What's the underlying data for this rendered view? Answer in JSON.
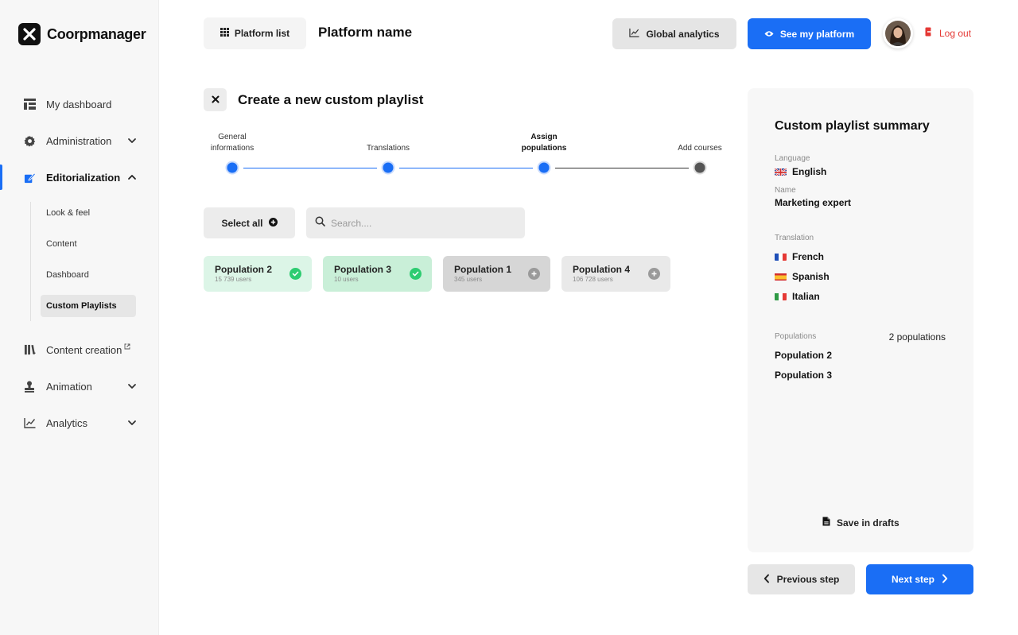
{
  "app": {
    "brand": "Coorpmanager",
    "accent": "#1a6ef5",
    "danger": "#e53935",
    "success": "#2ecc71"
  },
  "topbar": {
    "platform_list_label": "Platform list",
    "platform_name": "Platform name",
    "global_analytics_label": "Global analytics",
    "see_platform_label": "See my platform",
    "logout_label": "Log out"
  },
  "sidebar": {
    "items": [
      {
        "label": "My dashboard",
        "icon": "dashboard-icon"
      },
      {
        "label": "Administration",
        "icon": "gear-icon",
        "expandable": true
      },
      {
        "label": "Editorialization",
        "icon": "edit-icon",
        "expanded": true,
        "active": true
      },
      {
        "label": "Content creation",
        "icon": "library-icon",
        "external": true
      },
      {
        "label": "Animation",
        "icon": "stamp-icon",
        "expandable": true
      },
      {
        "label": "Analytics",
        "icon": "chart-icon",
        "expandable": true
      }
    ],
    "subitems": [
      {
        "label": "Look & feel"
      },
      {
        "label": "Content"
      },
      {
        "label": "Dashboard"
      },
      {
        "label": "Custom Playlists",
        "active": true
      }
    ]
  },
  "page": {
    "title": "Create a new custom playlist"
  },
  "stepper": {
    "steps": [
      {
        "line1": "General",
        "line2": "informations",
        "state": "done"
      },
      {
        "line1": "",
        "line2": "Translations",
        "state": "done"
      },
      {
        "line1": "Assign",
        "line2": "populations",
        "state": "current"
      },
      {
        "line1": "",
        "line2": "Add courses",
        "state": "todo"
      }
    ]
  },
  "selection": {
    "select_all_label": "Select all",
    "search_placeholder": "Search....",
    "search_value": ""
  },
  "populations": [
    {
      "name": "Population 2",
      "users": "15 739 users",
      "selected": true
    },
    {
      "name": "Population 3",
      "users": "10 users",
      "selected": true
    },
    {
      "name": "Population 1",
      "users": "345 users",
      "selected": false
    },
    {
      "name": "Population 4",
      "users": "106 728 users",
      "selected": false
    }
  ],
  "summary": {
    "title": "Custom playlist summary",
    "language_label": "Language",
    "language_value": "English",
    "name_label": "Name",
    "name_value": "Marketing expert",
    "translation_label": "Translation",
    "translations": [
      "French",
      "Spanish",
      "Italian"
    ],
    "populations_label": "Populations",
    "populations_count": "2 populations",
    "populations": [
      "Population 2",
      "Population 3"
    ],
    "save_label": "Save in drafts"
  },
  "footer": {
    "prev_label": "Previous step",
    "next_label": "Next step"
  }
}
